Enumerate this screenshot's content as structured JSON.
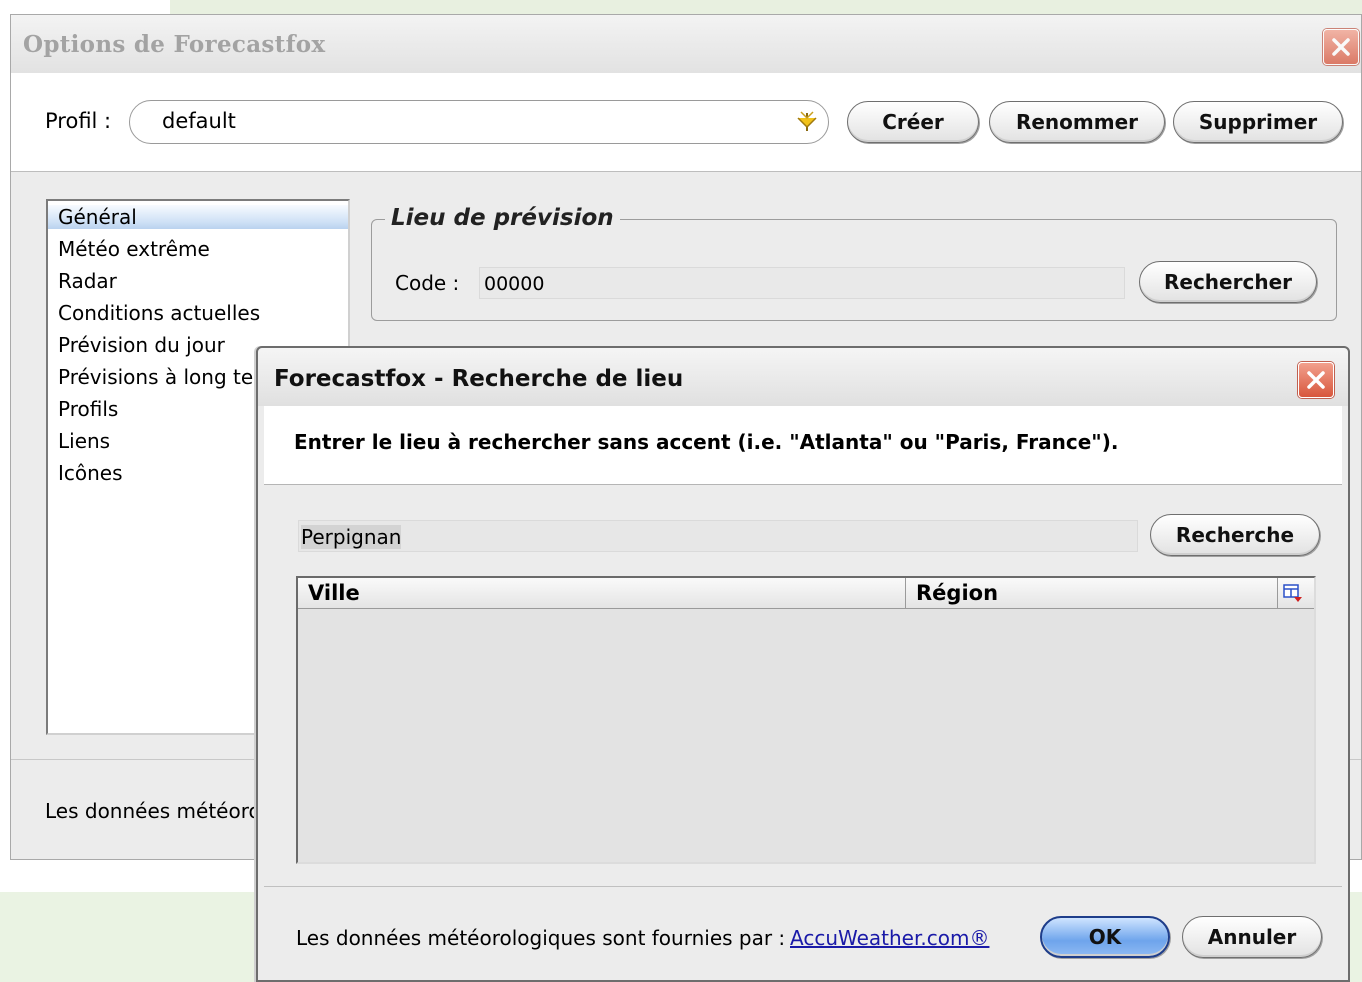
{
  "main_window": {
    "title": "Options de Forecastfox",
    "profile": {
      "label": "Profil :",
      "selected": "default",
      "buttons": {
        "create": "Créer",
        "rename": "Renommer",
        "delete": "Supprimer"
      }
    },
    "sidebar": {
      "items": [
        {
          "label": "Général",
          "selected": true
        },
        {
          "label": "Météo extrême"
        },
        {
          "label": "Radar"
        },
        {
          "label": "Conditions actuelles"
        },
        {
          "label": "Prévision du jour"
        },
        {
          "label": "Prévisions à long term"
        },
        {
          "label": "Profils"
        },
        {
          "label": "Liens"
        },
        {
          "label": "Icônes"
        }
      ]
    },
    "location_group": {
      "legend": "Lieu de prévision",
      "code_label": "Code :",
      "code_value": "00000",
      "search_button": "Rechercher"
    },
    "footer_text": "Les données météorol"
  },
  "search_dialog": {
    "title": "Forecastfox - Recherche de lieu",
    "instructions": "Entrer le lieu à rechercher sans accent (i.e. \"Atlanta\" ou \"Paris, France\").",
    "search_value": "Perpignan",
    "search_button": "Recherche",
    "columns": {
      "city": "Ville",
      "region": "Région"
    },
    "results": [],
    "footer_text": "Les données météorologiques sont fournies par :",
    "provider_link": "AccuWeather.com®",
    "ok_button": "OK",
    "cancel_button": "Annuler"
  },
  "colors": {
    "close_button": "#d8573d",
    "selection": "#cfe1f6",
    "ok_button": "#6ea4ec",
    "link": "#1a1aa8"
  }
}
